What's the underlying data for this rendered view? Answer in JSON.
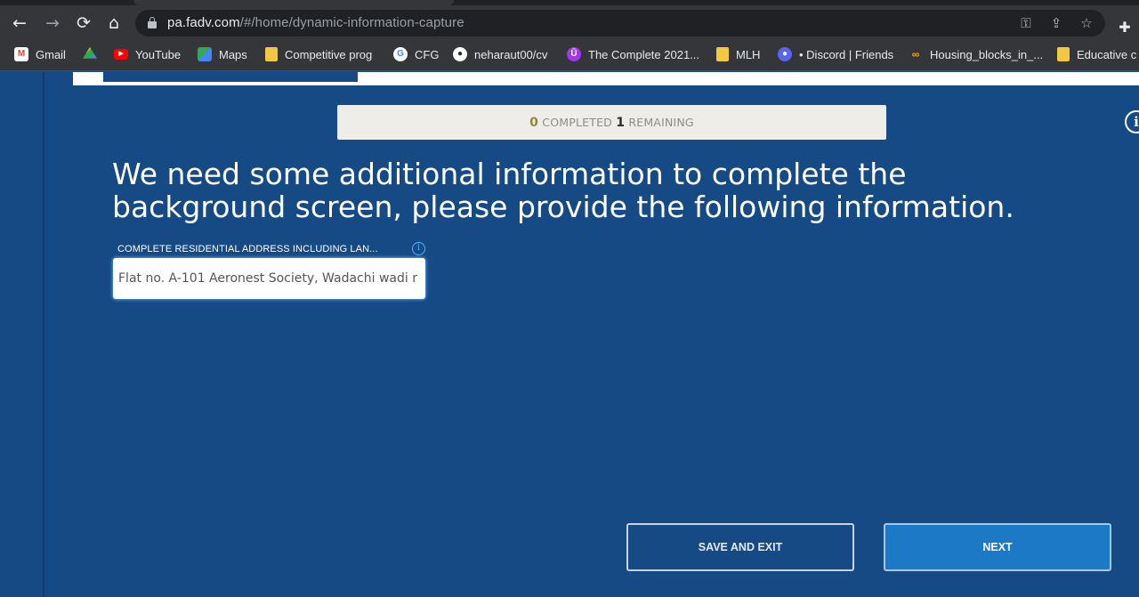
{
  "browser": {
    "url_host": "pa.fadv.com",
    "url_path": "/#/home/dynamic-information-capture",
    "nav": {
      "back": "←",
      "forward": "→",
      "reload": "⟳",
      "home": "⌂"
    },
    "bookmarks": [
      {
        "label": "Gmail",
        "icon": "gmail-icon",
        "color": "#ea4335"
      },
      {
        "label": "",
        "icon": "drive-icon",
        "color": "#34a853"
      },
      {
        "label": "YouTube",
        "icon": "youtube-icon",
        "color": "#ff0000"
      },
      {
        "label": "Maps",
        "icon": "maps-icon",
        "color": "#34a853"
      },
      {
        "label": "Competitive prog",
        "icon": "folder-icon",
        "color": "#f2c744"
      },
      {
        "label": "CFG",
        "icon": "google-icon",
        "color": "#4285f4"
      },
      {
        "label": "neharaut00/cv",
        "icon": "github-icon",
        "color": "#ffffff"
      },
      {
        "label": "The Complete 2021...",
        "icon": "udemy-icon",
        "color": "#a435f0"
      },
      {
        "label": "MLH",
        "icon": "folder-icon",
        "color": "#f2c744"
      },
      {
        "label": "• Discord | Friends",
        "icon": "discord-icon",
        "color": "#5865f2"
      },
      {
        "label": "Housing_blocks_in_...",
        "icon": "colab-icon",
        "color": "#f9ab00"
      },
      {
        "label": "Educative c",
        "icon": "folder-icon",
        "color": "#f2c744"
      }
    ]
  },
  "progress": {
    "completed": "0",
    "completed_label": "COMPLETED",
    "remaining": "1",
    "remaining_label": "REMAINING"
  },
  "help": {
    "icon": "info-icon",
    "glyph": "i"
  },
  "headline": "We need some additional information to complete the background screen, please provide the following information.",
  "field": {
    "label": "COMPLETE RESIDENTIAL ADDRESS INCLUDING LAN...",
    "info_glyph": "i",
    "value": "Flat no. A-101 Aeronest Society, Wadachi wadi r"
  },
  "buttons": {
    "save_exit": "SAVE AND EXIT",
    "next": "NEXT"
  },
  "colors": {
    "page_bg": "#154a85",
    "next_bg": "#1b79c6",
    "progress_bg": "#eeedea"
  }
}
